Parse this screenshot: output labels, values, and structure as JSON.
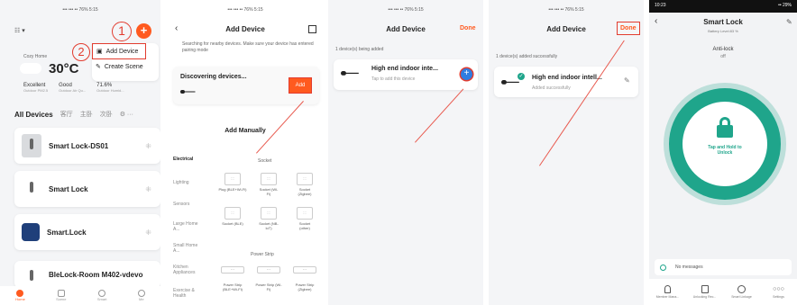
{
  "colors": {
    "accent": "#ff5a1f",
    "teal": "#1fa58b",
    "blue": "#2f7de1",
    "annotation": "#e23c2f"
  },
  "panel1": {
    "status": "••• ••• •• 76% 5:15",
    "home_label": "Cozy Home",
    "temperature": "30°C",
    "weather": [
      {
        "value": "Excellent",
        "label": "Outdoor PM2.5"
      },
      {
        "value": "Good",
        "label": "Outdoor Air Qu..."
      },
      {
        "value": "71.6%",
        "label": "Outdoor Humid..."
      }
    ],
    "tabs": [
      "All Devices",
      "客厅",
      "主卧",
      "次卧"
    ],
    "devices": [
      "Smart Lock-DS01",
      "Smart Lock",
      "Smart.Lock",
      "BleLock-Room M402-vdevo"
    ],
    "annotation_1": "1",
    "annotation_2": "2",
    "menu": [
      "Add Device",
      "Create Scene"
    ],
    "bottom_nav": [
      "Home",
      "Scene",
      "Smart",
      "Me"
    ]
  },
  "panel2": {
    "status": "••• ••• •• 76% 5:15",
    "title": "Add Device",
    "search_note": "Searching for nearby devices. Make sure your device has entered pairing mode",
    "pairing_link": "pairing mode",
    "discovering": "Discovering devices...",
    "add_button": "Add",
    "add_manually": "Add Manually",
    "categories": [
      "Electrical",
      "Lighting",
      "Sensors",
      "Large Home A...",
      "Small Home A...",
      "Kitchen Appliances",
      "Exercise & Health"
    ],
    "socket_header": "Socket",
    "power_strip_header": "Power Strip",
    "socket_items": [
      "Plug (BLE+Wi-Fi)",
      "Socket (Wi-Fi)",
      "Socket (Zigbee)",
      "Socket (BLE)",
      "Socket (NB-IoT)",
      "Socket (other)"
    ],
    "strip_items": [
      "Power Strip (BLE+Wi-Fi)",
      "Power Strip (Wi-Fi)",
      "Power Strip (Zigbee)"
    ]
  },
  "panel3": {
    "status": "••• ••• •• 76% 5:15",
    "title": "Add Device",
    "done": "Done",
    "count_note": "1 device(s) being added",
    "device_name": "High end indoor inte...",
    "device_sub": "Tap to add this device"
  },
  "panel4": {
    "status": "••• ••• •• 76% 5:15",
    "title": "Add Device",
    "done": "Done",
    "count_note": "1 device(s) added successfully",
    "device_name": "High end indoor intell...",
    "device_sub": "Added successfully"
  },
  "panel5": {
    "status_time": "10:23",
    "status_right": "•• 29%",
    "title": "Smart Lock",
    "battery": "Battery Level:83 %",
    "anti_lock": "Anti-lock",
    "anti_lock_state": "off",
    "tap_hold": "Tap and Hold to Unlock",
    "messages": "No messages",
    "bottom_nav": [
      "Member Mana...",
      "Unlocking Rec...",
      "Smart Linkage",
      "Settings"
    ]
  }
}
